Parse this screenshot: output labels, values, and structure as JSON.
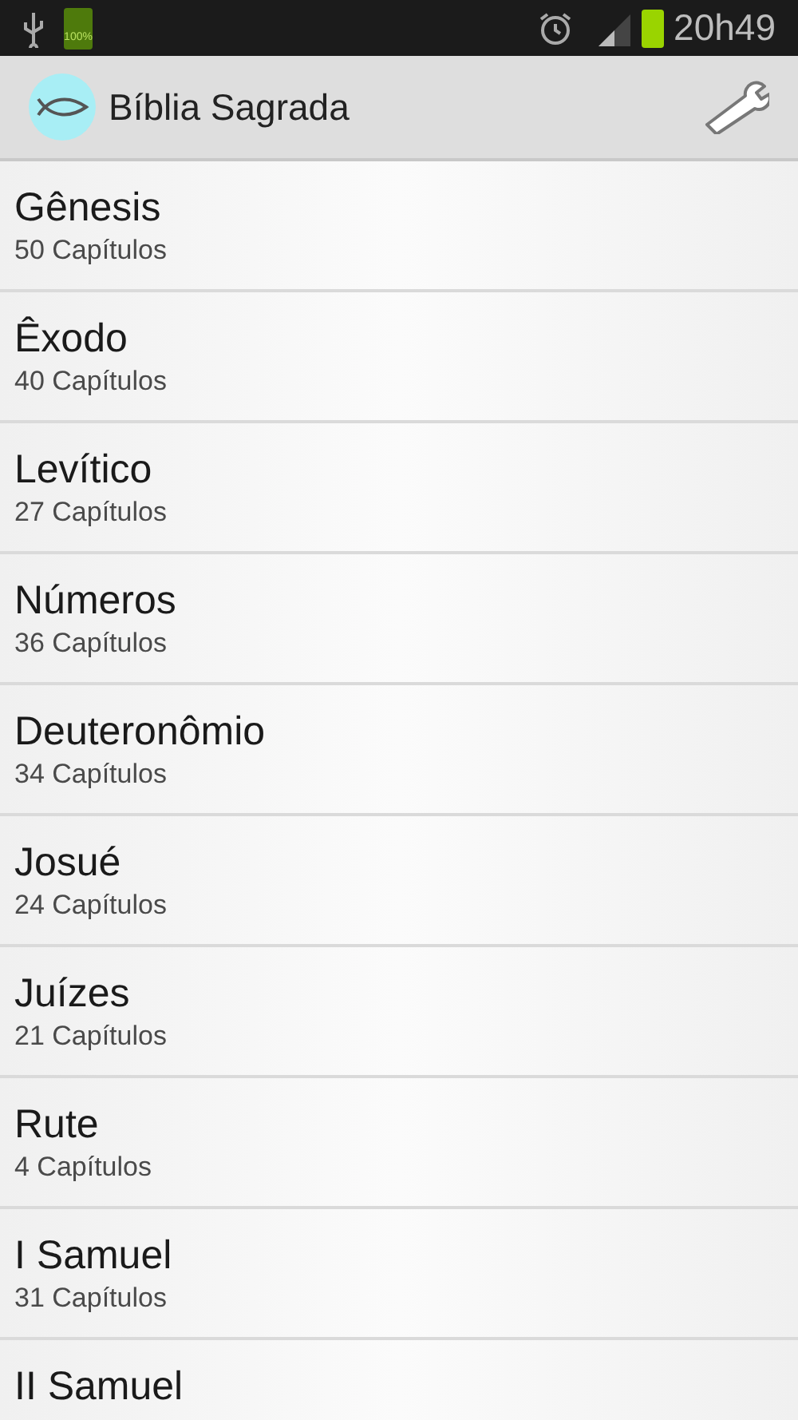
{
  "status_bar": {
    "battery_label": "100%",
    "time": "20h49"
  },
  "app_bar": {
    "title": "Bíblia Sagrada"
  },
  "books": [
    {
      "name": "Gênesis",
      "chapters": "50 Capítulos"
    },
    {
      "name": "Êxodo",
      "chapters": "40 Capítulos"
    },
    {
      "name": "Levítico",
      "chapters": "27 Capítulos"
    },
    {
      "name": "Números",
      "chapters": "36 Capítulos"
    },
    {
      "name": "Deuteronômio",
      "chapters": "34 Capítulos"
    },
    {
      "name": "Josué",
      "chapters": "24 Capítulos"
    },
    {
      "name": "Juízes",
      "chapters": "21 Capítulos"
    },
    {
      "name": "Rute",
      "chapters": "4 Capítulos"
    },
    {
      "name": "I Samuel",
      "chapters": "31 Capítulos"
    },
    {
      "name": "II Samuel"
    }
  ]
}
